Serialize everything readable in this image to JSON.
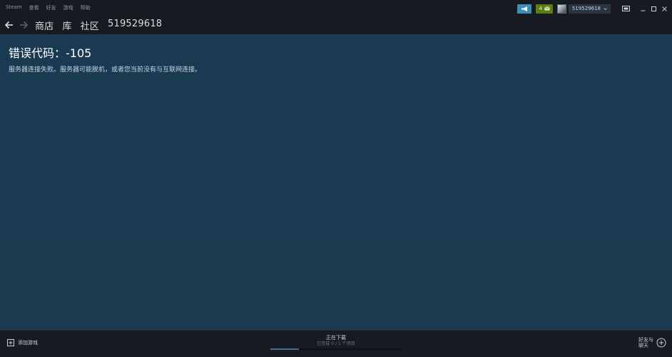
{
  "titlebar": {
    "menu": [
      "Steam",
      "查看",
      "好友",
      "游戏",
      "帮助"
    ],
    "notifications_count": "4",
    "account_name": "519529618"
  },
  "navbar": {
    "links": [
      "商店",
      "库",
      "社区",
      "519529618"
    ]
  },
  "content": {
    "error_title": "错误代码：-105",
    "error_message": "服务器连接失败。服务器可能脱机，或者您当前没有与互联网连接。"
  },
  "bottombar": {
    "add_game_label": "添加游戏",
    "downloads_title": "正在下载",
    "downloads_status": "已完成 0 / 1 个项目",
    "downloads_progress": 0.22,
    "friends_label_line1": "好友与",
    "friends_label_line2": "聊天"
  },
  "colors": {
    "accent_blue": "#3d8eb9",
    "notification_green": "#5c7e10",
    "content_bg": "#1b3a50",
    "chrome_bg": "#171a21"
  },
  "icons": {
    "announce": "megaphone-icon",
    "notifications": "envelope-icon",
    "big_picture": "big-picture-icon",
    "minimize": "minimize-icon",
    "maximize": "maximize-icon",
    "close": "close-icon",
    "back": "back-arrow-icon",
    "forward": "forward-arrow-icon",
    "add": "plus-box-icon",
    "friends": "plus-circle-icon"
  }
}
